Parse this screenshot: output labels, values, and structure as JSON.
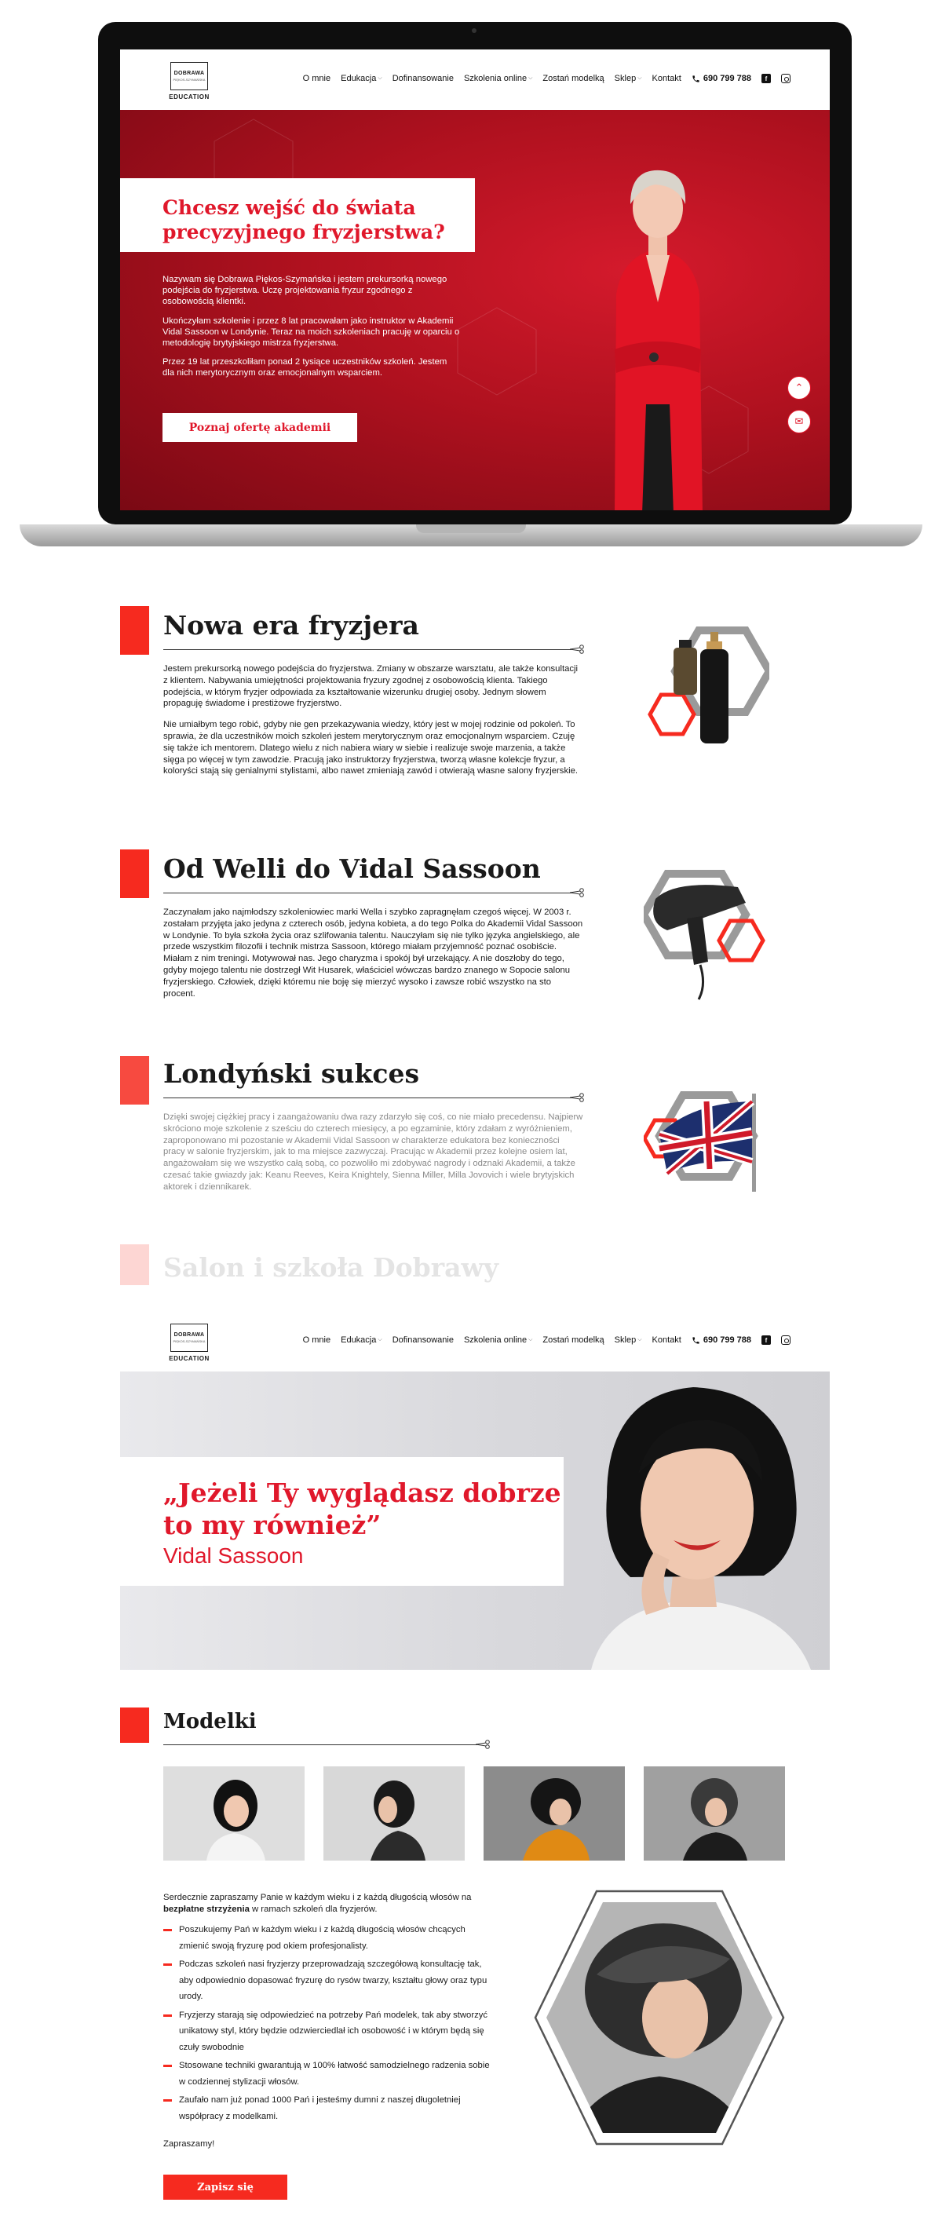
{
  "brand": {
    "name": "DOBRAWA",
    "sub": "PIĘKOS-SZYMAŃSKA",
    "edu": "EDUCATION"
  },
  "nav": {
    "items": [
      {
        "label": "O mnie",
        "dropdown": false
      },
      {
        "label": "Edukacja",
        "dropdown": true
      },
      {
        "label": "Dofinansowanie",
        "dropdown": false
      },
      {
        "label": "Szkolenia online",
        "dropdown": true
      },
      {
        "label": "Zostań modelką",
        "dropdown": false
      },
      {
        "label": "Sklep",
        "dropdown": true
      },
      {
        "label": "Kontakt",
        "dropdown": false
      }
    ],
    "phone": "690 799 788",
    "chevron": "⌵",
    "facebook_glyph": "f"
  },
  "hero": {
    "title": "Chcesz wejść do świata precyzyjnego fryzjerstwa?",
    "paragraphs": [
      "Nazywam się Dobrawa Piękos-Szymańska i jestem prekursorką nowego podejścia do fryzjerstwa. Uczę projektowania fryzur zgodnego z osobowością klientki.",
      "Ukończyłam szkolenie i przez 8 lat pracowałam jako instruktor w Akademii Vidal Sassoon w Londynie. Teraz na moich szkoleniach pracuję w oparciu o metodologię brytyjskiego mistrza fryzjerstwa.",
      "Przez 19 lat przeszkoliłam ponad 2 tysiące uczestników szkoleń. Jestem dla nich merytorycznym oraz emocjonalnym wsparciem."
    ],
    "cta": "Poznaj ofertę akademii",
    "scroll_top_glyph": "⌃",
    "chat_glyph": "✉"
  },
  "sections": [
    {
      "title": "Nowa era fryzjera",
      "paragraphs": [
        "Jestem prekursorką nowego podejścia do fryzjerstwa. Zmiany w obszarze warsztatu, ale także konsultacji z klientem. Nabywania umiejętności projektowania fryzury zgodnej z osobowością klienta. Takiego podejścia, w którym fryzjer odpowiada za kształtowanie wizerunku drugiej osoby. Jednym słowem propaguję świadome i prestiżowe fryzjerstwo.",
        "Nie umiałbym tego robić, gdyby nie gen przekazywania wiedzy, który jest w mojej rodzinie od pokoleń. To sprawia, że dla uczestników moich szkoleń jestem merytorycznym oraz emocjonalnym wsparciem. Czuję się także ich mentorem. Dlatego wielu z nich nabiera wiary w siebie i realizuje swoje marzenia, a także sięga po więcej w tym zawodzie. Pracują jako instruktorzy fryzjerstwa, tworzą własne kolekcje fryzur, a koloryści stają się genialnymi stylistami, albo nawet zmieniają zawód i otwierają własne salony fryzjerskie."
      ]
    },
    {
      "title": "Od Welli do Vidal Sassoon",
      "paragraphs": [
        "Zaczynałam jako najmłodszy szkoleniowiec marki Wella i szybko zapragnęłam czegoś więcej. W 2003 r. zostałam przyjęta jako jedyna z czterech osób, jedyna kobieta, a do tego Polka do Akademii Vidal Sassoon w Londynie. To była szkoła życia oraz szlifowania talentu. Nauczyłam się nie tylko języka angielskiego, ale przede wszystkim filozofii i technik mistrza Sassoon, którego miałam przyjemność poznać osobiście. Miałam z nim treningi. Motywował nas. Jego charyzma i spokój był urzekający. A nie doszłoby do tego, gdyby mojego talentu nie dostrzegł Wit Husarek, właściciel wówczas bardzo znanego w Sopocie salonu fryzjerskiego. Człowiek, dzięki któremu nie boję się mierzyć wysoko i zawsze robić wszystko na sto procent."
      ]
    },
    {
      "title": "Londyński sukces",
      "paragraphs": [
        "Dzięki swojej ciężkiej pracy i zaangażowaniu dwa razy zdarzyło się coś, co nie miało precedensu. Najpierw skróciono moje szkolenie z sześciu do czterech miesięcy, a po egzaminie, który zdałam z wyróżnieniem, zaproponowano mi pozostanie w Akademii Vidal Sassoon w charakterze edukatora bez konieczności pracy w salonie fryzjerskim, jak to ma miejsce zazwyczaj. Pracując w Akademii przez kolejne osiem lat, angażowałam się we wszystko całą sobą, co pozwoliło mi zdobywać nagrody i odznaki Akademii, a także czesać takie gwiazdy jak: Keanu Reeves, Keira Knightely, Sienna Miller, Milla Jovovich i wiele brytyjskich aktorek i dziennikarek."
      ]
    }
  ],
  "ghost_section": {
    "title": "Salon i szkoła Dobrawy"
  },
  "quote": {
    "text": "„Jeżeli Ty wyglądasz dobrze to my również”",
    "author": "Vidal Sassoon"
  },
  "models": {
    "title": "Modelki",
    "intro_a": "Serdecznie zapraszamy Panie w każdym wieku i z każdą długością włosów na ",
    "intro_b": "bezpłatne strzyżenia",
    "intro_c": " w ramach szkoleń dla fryzjerów.",
    "list": [
      "Poszukujemy Pań w każdym wieku i z każdą długością włosów chcących zmienić swoją fryzurę pod okiem profesjonalisty.",
      "Podczas szkoleń nasi fryzjerzy przeprowadzają szczegółową konsultację tak, aby odpowiednio dopasować fryzurę do rysów twarzy, kształtu głowy oraz typu urody.",
      "Fryzjerzy starają się odpowiedzieć na potrzeby Pań modelek, tak aby stworzyć unikatowy styl, który będzie odzwierciedlał ich osobowość i w którym będą się czuły swobodnie",
      "Stosowane techniki gwarantują w 100% łatwość samodzielnego radzenia sobie w codziennej stylizacji włosów.",
      "Zaufało nam już ponad 1000 Pań i jesteśmy dumni z naszej długoletniej współpracy z modelkami."
    ],
    "thanks": "Zapraszamy!",
    "cta": "Zapisz się"
  },
  "colors": {
    "accent": "#e0182b",
    "marker": "#f62a1f",
    "hero_bg": "#b0111f"
  }
}
